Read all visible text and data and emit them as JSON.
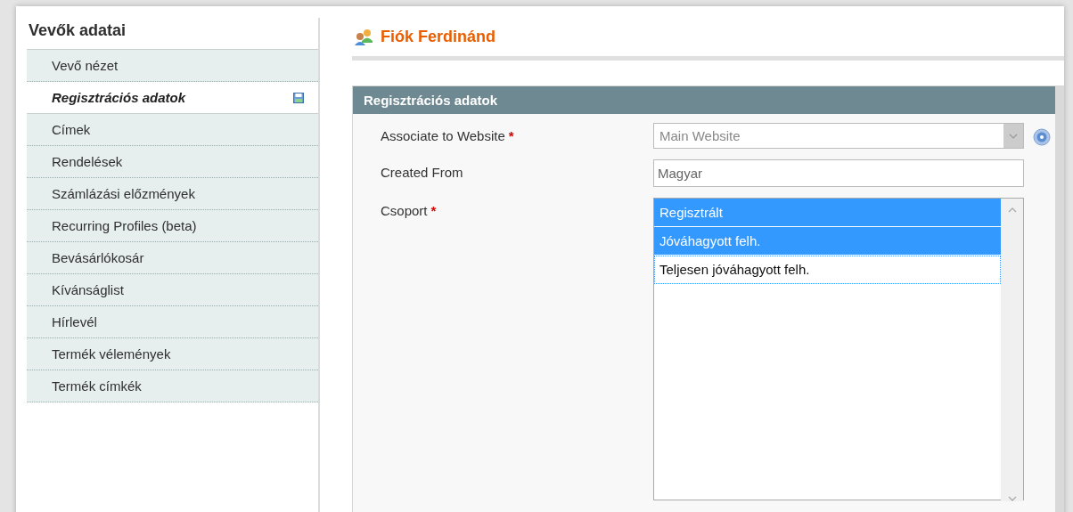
{
  "sidebar": {
    "title": "Vevők adatai",
    "items": [
      {
        "label": "Vevő nézet",
        "selected": false
      },
      {
        "label": "Regisztrációs adatok",
        "selected": true
      },
      {
        "label": "Címek",
        "selected": false
      },
      {
        "label": "Rendelések",
        "selected": false
      },
      {
        "label": "Számlázási előzmények",
        "selected": false
      },
      {
        "label": "Recurring Profiles (beta)",
        "selected": false
      },
      {
        "label": "Bevásárlókosár",
        "selected": false
      },
      {
        "label": "Kívánságlist",
        "selected": false
      },
      {
        "label": "Hírlevél",
        "selected": false
      },
      {
        "label": "Termék vélemények",
        "selected": false
      },
      {
        "label": "Termék címkék",
        "selected": false
      }
    ]
  },
  "page_title": "Fiók Ferdinánd",
  "section": {
    "title": "Regisztrációs adatok",
    "fields": [
      {
        "kind": "select",
        "label": "Associate to Website",
        "required_mark": "*",
        "value": "Main Website",
        "disabled": true
      },
      {
        "kind": "text",
        "label": "Created From",
        "value": "Magyar"
      },
      {
        "kind": "multiselect",
        "label": "Csoport",
        "required_mark": "*",
        "options": [
          {
            "label": "Regisztrált",
            "selected": true,
            "focused": false
          },
          {
            "label": "Jóváhagyott felh.",
            "selected": true,
            "focused": false
          },
          {
            "label": "Teljesen jóváhagyott felh.",
            "selected": false,
            "focused": true
          }
        ]
      }
    ]
  }
}
